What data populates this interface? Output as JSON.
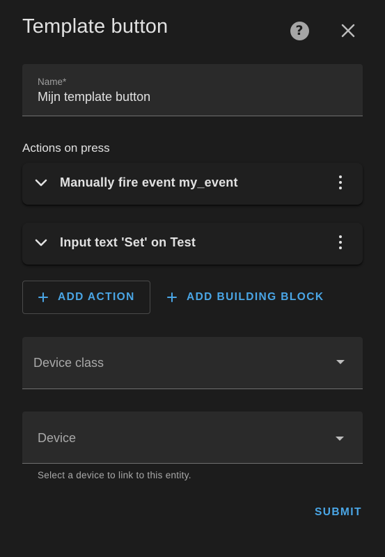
{
  "dialog": {
    "title": "Template button",
    "help_icon": "help-circle-icon",
    "close_icon": "close-icon"
  },
  "name_field": {
    "label": "Name*",
    "value": "Mijn template button"
  },
  "actions": {
    "heading": "Actions on press",
    "items": [
      {
        "label": "Manually fire event my_event"
      },
      {
        "label": "Input text 'Set' on Test"
      }
    ],
    "add_action_label": "ADD ACTION",
    "add_building_block_label": "ADD BUILDING BLOCK"
  },
  "device_class_field": {
    "placeholder": "Device class"
  },
  "device_field": {
    "placeholder": "Device",
    "helper": "Select a device to link to this entity."
  },
  "footer": {
    "submit_label": "SUBMIT"
  },
  "colors": {
    "background": "#1c1c1c",
    "surface": "#2a2a2a",
    "accent": "#4aa6e6",
    "text": "#e1e1e1"
  }
}
